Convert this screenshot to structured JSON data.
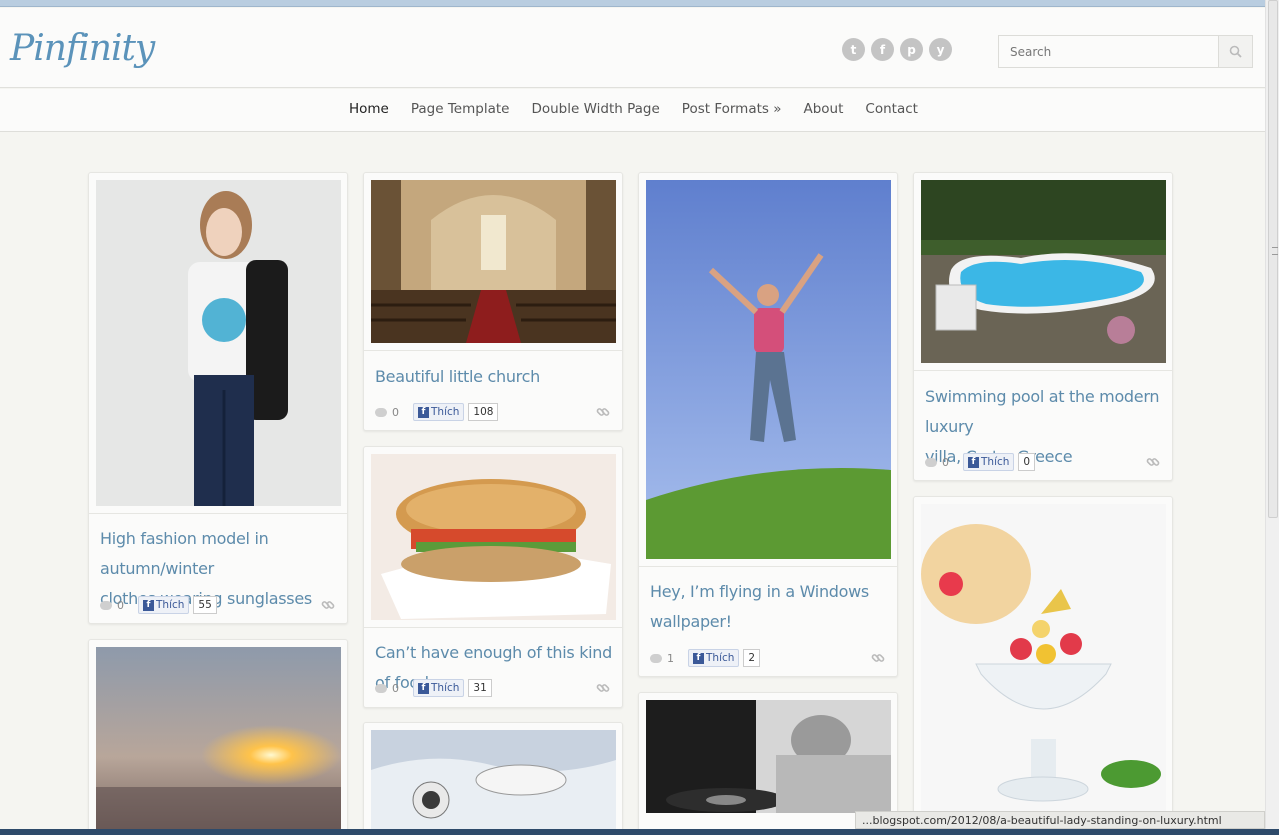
{
  "site": {
    "logo": "Pinfinity"
  },
  "social": [
    {
      "name": "twitter",
      "glyph": "t"
    },
    {
      "name": "facebook",
      "glyph": "f"
    },
    {
      "name": "pinterest",
      "glyph": "p"
    },
    {
      "name": "youtube",
      "glyph": "y"
    }
  ],
  "search": {
    "placeholder": "Search"
  },
  "nav": [
    "Home",
    "Page Template",
    "Double Width Page",
    "Post Formats »",
    "About",
    "Contact"
  ],
  "posts": [
    {
      "title_lines": [
        "High fashion model in autumn/winter",
        "clothes wearing sunglasses"
      ],
      "comments": "0",
      "like_label": "Thích",
      "likes": "55"
    },
    {
      "title_lines": [
        "Beautiful little church"
      ],
      "comments": "0",
      "like_label": "Thích",
      "likes": "108"
    },
    {
      "title_lines": [
        "Can’t have enough of this kind of food"
      ],
      "comments": "0",
      "like_label": "Thích",
      "likes": "31"
    },
    {
      "title_lines": [
        "Hey, I’m flying in a Windows",
        "wallpaper!"
      ],
      "comments": "1",
      "like_label": "Thích",
      "likes": "2"
    },
    {
      "title_lines": [
        "Swimming pool at the modern luxury",
        "villa, Crete, Greece"
      ],
      "comments": "0",
      "like_label": "Thích",
      "likes": "0"
    }
  ],
  "status_url": "...blogspot.com/2012/08/a-beautiful-lady-standing-on-luxury.html",
  "colors": {
    "title": "#5d8bab",
    "logo": "#5b93ba",
    "fb": "#3b5998"
  }
}
